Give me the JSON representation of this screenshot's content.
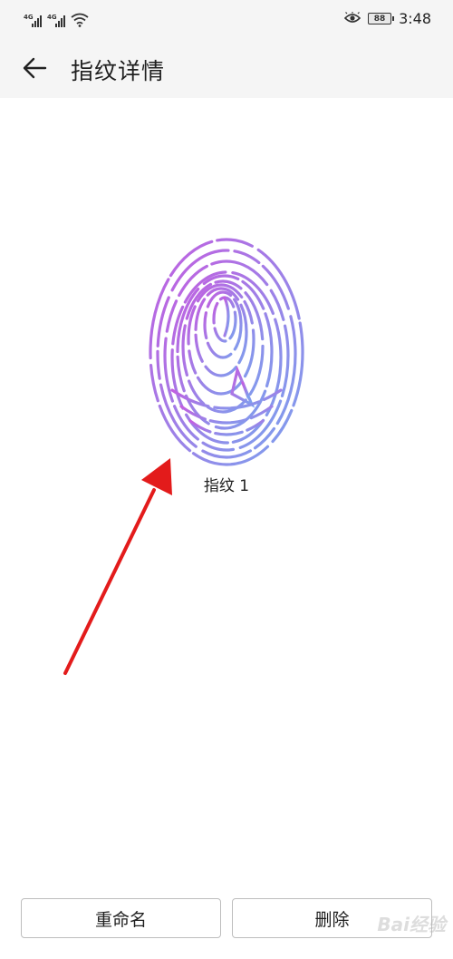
{
  "status_bar": {
    "sim1_label": "4G",
    "sim2_label": "4G",
    "battery_level": "88",
    "time": "3:48",
    "icons": [
      "signal-icon",
      "signal-icon",
      "wifi-icon",
      "eye-comfort-icon",
      "battery-icon"
    ]
  },
  "header": {
    "title": "指纹详情",
    "back_icon": "back-arrow-icon"
  },
  "fingerprint": {
    "name": "指纹 1",
    "icon": "fingerprint-icon",
    "gradient": [
      "#c35ee0",
      "#7aa2ee"
    ]
  },
  "annotation": {
    "icon": "red-arrow-icon",
    "color": "#e31b1b"
  },
  "actions": {
    "rename_label": "重命名",
    "delete_label": "删除"
  },
  "watermark": {
    "text": "Bai经验"
  }
}
